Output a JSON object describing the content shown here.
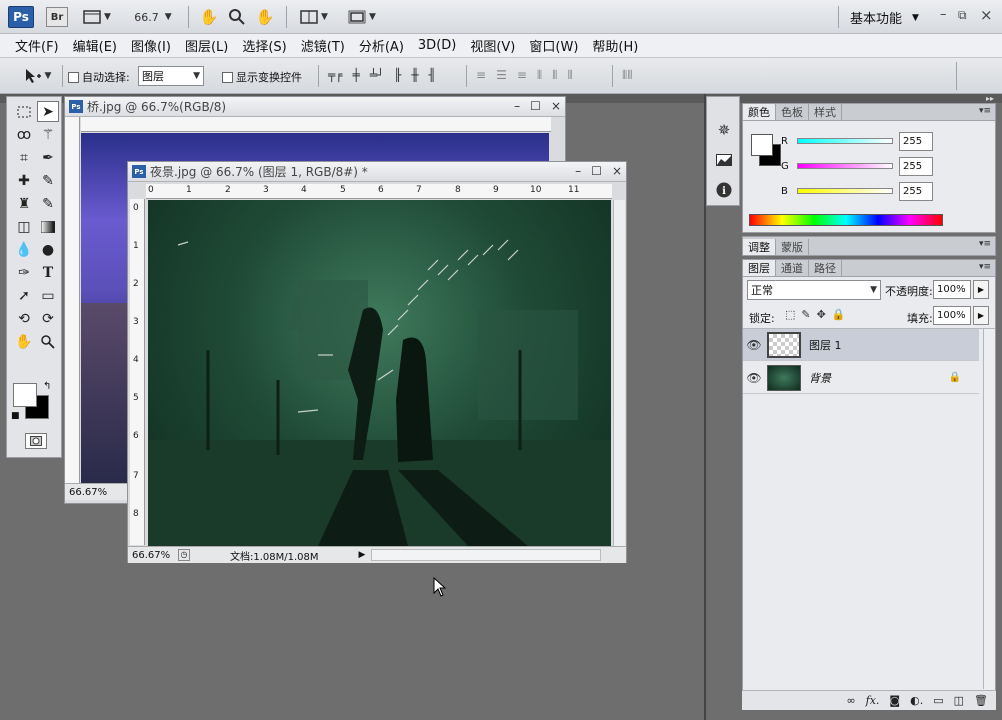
{
  "appbar": {
    "ps_logo": "Ps",
    "br_logo": "Br",
    "zoom": "66.7",
    "workspace": "基本功能"
  },
  "menu": [
    "文件(F)",
    "编辑(E)",
    "图像(I)",
    "图层(L)",
    "选择(S)",
    "滤镜(T)",
    "分析(A)",
    "3D(D)",
    "视图(V)",
    "窗口(W)",
    "帮助(H)"
  ],
  "options": {
    "auto_select_label": "自动选择:",
    "auto_select_value": "图层",
    "show_transform_label": "显示变换控件"
  },
  "doc1": {
    "title": "桥.jpg @ 66.7%(RGB/8)",
    "zoom": "66.67%"
  },
  "doc2": {
    "title": "夜景.jpg @ 66.7% (图层 1, RGB/8#) *",
    "zoom": "66.67%",
    "doc_info": "文档:1.08M/1.08M",
    "ruler_h": [
      "0",
      "1",
      "2",
      "3",
      "4",
      "5",
      "6",
      "7",
      "8",
      "9",
      "10",
      "11"
    ],
    "ruler_v": [
      "0",
      "1",
      "2",
      "3",
      "4",
      "5",
      "6",
      "7",
      "8"
    ]
  },
  "color_panel": {
    "tabs": [
      "颜色",
      "色板",
      "样式"
    ],
    "r_label": "R",
    "g_label": "G",
    "b_label": "B",
    "r": "255",
    "g": "255",
    "b": "255"
  },
  "adjust_panel": {
    "tabs": [
      "调整",
      "蒙版"
    ]
  },
  "layers_panel": {
    "tabs": [
      "图层",
      "通道",
      "路径"
    ],
    "blend_mode": "正常",
    "opacity_label": "不透明度:",
    "opacity": "100%",
    "lock_label": "锁定:",
    "fill_label": "填充:",
    "fill": "100%",
    "layers": [
      {
        "name": "图层 1"
      },
      {
        "name": "背景"
      }
    ]
  },
  "bottom_icons": [
    "link-icon",
    "fx-icon",
    "mask-icon",
    "adjustment-icon",
    "group-icon",
    "new-layer-icon",
    "trash-icon"
  ]
}
